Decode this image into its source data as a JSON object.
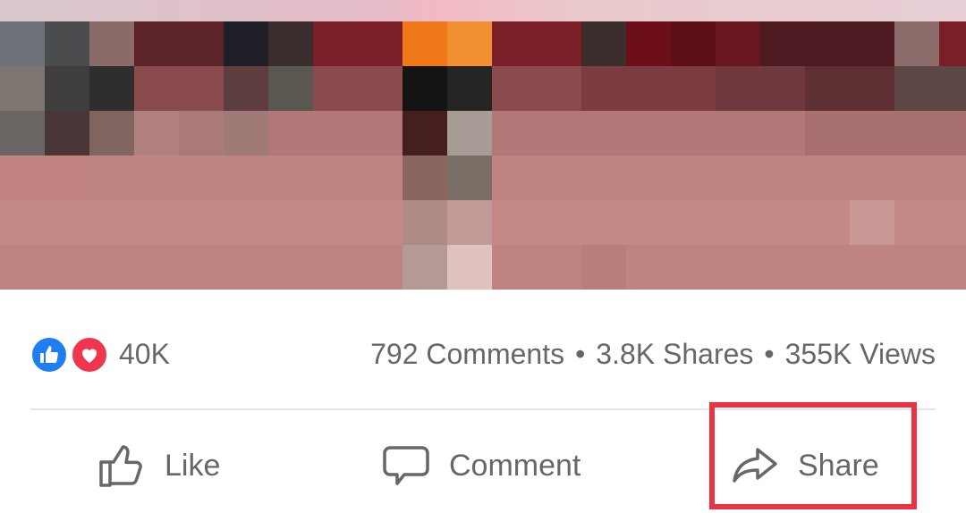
{
  "post": {
    "media": {
      "description_icon": "blurred-video-thumbnail"
    },
    "stats": {
      "reaction_count": "40K",
      "reactions": [
        "like",
        "love"
      ],
      "comments": "792 Comments",
      "separator": "•",
      "shares": "3.8K Shares",
      "views": "355K Views"
    },
    "actions": {
      "like_label": "Like",
      "comment_label": "Comment",
      "share_label": "Share"
    }
  },
  "colors": {
    "like_blue": "#1f7ef2",
    "love_red": "#f0364f",
    "text_gray": "#65676b",
    "highlight_red": "#e83544"
  }
}
